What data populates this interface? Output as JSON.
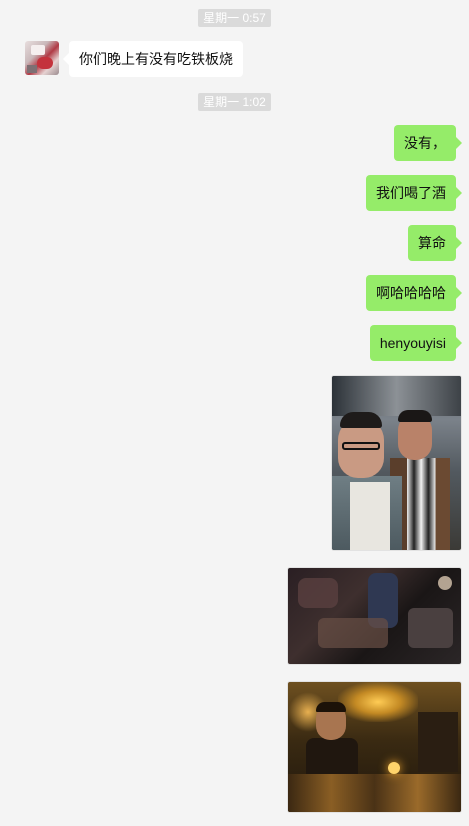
{
  "chat": {
    "timestamps": [
      "星期一 0:57",
      "星期一 1:02"
    ],
    "incoming": [
      {
        "text": "你们晚上有没有吃铁板烧"
      }
    ],
    "outgoing": [
      {
        "text": "没有，"
      },
      {
        "text": "我们喝了酒"
      },
      {
        "text": "算命"
      },
      {
        "text": "啊哈哈哈哈"
      },
      {
        "text": "henyouyisi"
      }
    ],
    "images": [
      {
        "icon": "selfie-photo"
      },
      {
        "icon": "dark-bar-photo"
      },
      {
        "icon": "lit-bar-photo"
      }
    ]
  },
  "colors": {
    "background": "#f4f4f4",
    "outgoing_bubble": "#95ec69",
    "incoming_bubble": "#ffffff",
    "timestamp_bg": "#dadada"
  }
}
